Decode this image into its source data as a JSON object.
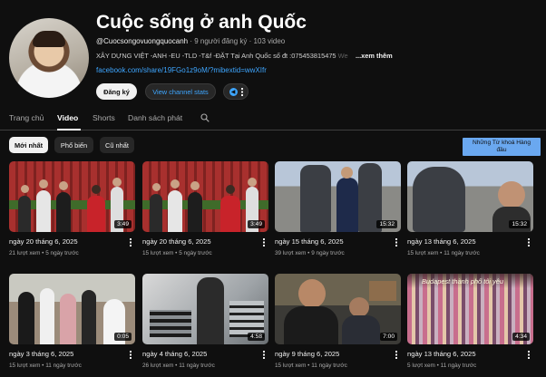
{
  "channel": {
    "name": "Cuộc sống ở anh Quốc",
    "handle": "@Cuocsongovuongquocanh",
    "subscribers": "9 người đăng ký",
    "video_count": "103 video",
    "description": "XÂY DỰNG  VIỆT -ANH  -EU  -TLD  -T&f  -ĐẶT Tại Anh Quốc số đt :075453815475",
    "description_fade": "  We",
    "more_label": "...xem thêm",
    "link": "facebook.com/share/19FGo1z9oM/?mibextid=wwXIfr",
    "subscribe_label": "Đăng ký",
    "stats_label": "View channel stats"
  },
  "tabs": [
    {
      "label": "Trang chủ"
    },
    {
      "label": "Video"
    },
    {
      "label": "Shorts"
    },
    {
      "label": "Danh sách phát"
    }
  ],
  "filters": [
    {
      "label": "Mới nhất"
    },
    {
      "label": "Phổ biến"
    },
    {
      "label": "Cũ nhất"
    }
  ],
  "keyword_button": {
    "line1": "Những Từ khoá Hàng",
    "line2": "đầu"
  },
  "videos": [
    {
      "title": "ngày 20 tháng 6, 2025",
      "views": "21 lượt xem",
      "age": "5 ngày trước",
      "duration": "3:49"
    },
    {
      "title": "ngày 20 tháng 6, 2025",
      "views": "15 lượt xem",
      "age": "5 ngày trước",
      "duration": "3:49"
    },
    {
      "title": "ngày 15 tháng 6, 2025",
      "views": "39 lượt xem",
      "age": "9 ngày trước",
      "duration": "15:32"
    },
    {
      "title": "ngày 13 tháng 6, 2025",
      "views": "15 lượt xem",
      "age": "11 ngày trước",
      "duration": "15:32"
    },
    {
      "title": "ngày 3 tháng 6, 2025",
      "views": "15 lượt xem",
      "age": "11 ngày trước",
      "duration": "0:05"
    },
    {
      "title": "ngày 4 tháng 6, 2025",
      "views": "26 lượt xem",
      "age": "11 ngày trước",
      "duration": "4:58"
    },
    {
      "title": "ngày 9 tháng 6, 2025",
      "views": "15 lượt xem",
      "age": "11 ngày trước",
      "duration": "7:00"
    },
    {
      "title": "ngày 13 tháng 6, 2025",
      "views": "5 lượt xem",
      "age": "11 ngày trước",
      "duration": "4:34",
      "overlay": "Budapest thành phố tôi yêu"
    }
  ]
}
